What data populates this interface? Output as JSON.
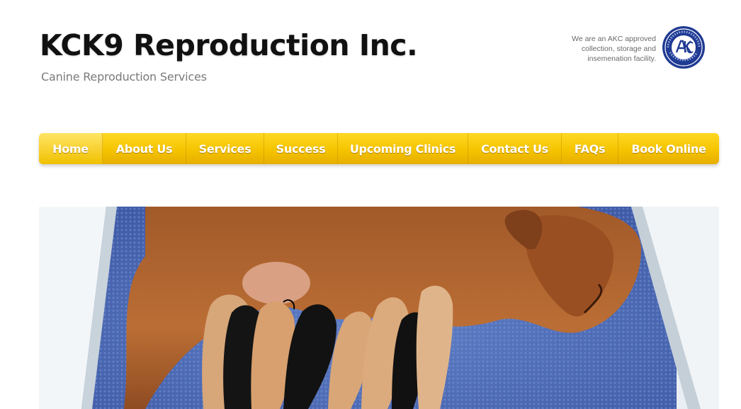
{
  "header": {
    "title": "KCK9 Reproduction Inc.",
    "tagline": "Canine Reproduction Services",
    "akc_note_lines": [
      "We are an AKC approved",
      "collection, storage and",
      "insemenation facility."
    ],
    "akc_logo_icon": "akc-seal-icon"
  },
  "nav": {
    "items": [
      {
        "label": "Home",
        "active": true
      },
      {
        "label": "About Us"
      },
      {
        "label": "Services"
      },
      {
        "label": "Success"
      },
      {
        "label": "Upcoming Clinics"
      },
      {
        "label": "Contact Us"
      },
      {
        "label": "FAQs"
      },
      {
        "label": "Book Online"
      }
    ]
  },
  "hero": {
    "image_icon": "nursing-puppies-photo"
  },
  "colors": {
    "nav_gold": "#f5c400",
    "nav_active": "#ffe566",
    "akc_blue": "#1f3a93",
    "title": "#111111",
    "tagline": "#7a7a7a"
  }
}
